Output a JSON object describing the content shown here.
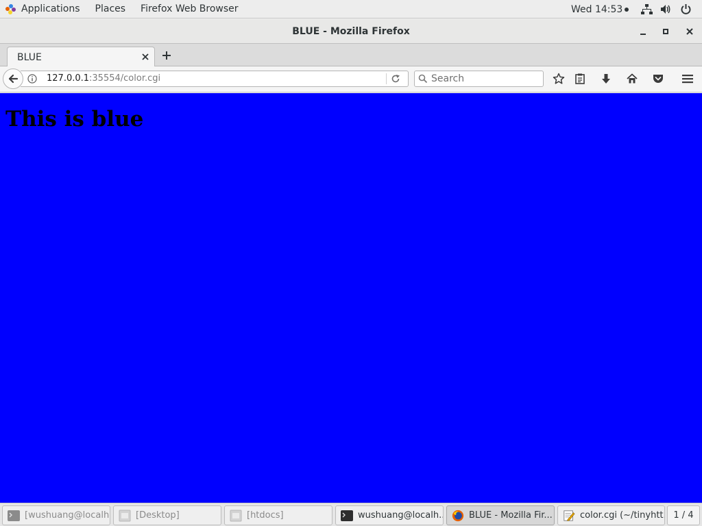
{
  "topbar": {
    "applications": "Applications",
    "places": "Places",
    "active_app": "Firefox Web Browser",
    "clock": "Wed 14:53"
  },
  "window": {
    "title": "BLUE - Mozilla Firefox"
  },
  "tabs": [
    {
      "label": "BLUE"
    }
  ],
  "navbar": {
    "url_host": "127.0.0.1",
    "url_rest": ":35554/color.cgi",
    "search_placeholder": "Search"
  },
  "page": {
    "heading": "This is blue",
    "background_color": "#0000ff"
  },
  "taskbar": {
    "items": [
      {
        "label": "[wushuang@localh...",
        "icon": "terminal-icon",
        "state": "minimized"
      },
      {
        "label": "[Desktop]",
        "icon": "folder-icon",
        "state": "minimized"
      },
      {
        "label": "[htdocs]",
        "icon": "folder-icon",
        "state": "minimized"
      },
      {
        "label": "wushuang@localh...",
        "icon": "terminal-icon",
        "state": "normal"
      },
      {
        "label": "BLUE - Mozilla Fir...",
        "icon": "firefox-icon",
        "state": "active"
      },
      {
        "label": "color.cgi (~/tinyhtt...",
        "icon": "text-editor-icon",
        "state": "normal"
      }
    ],
    "workspace": "1 / 4"
  }
}
